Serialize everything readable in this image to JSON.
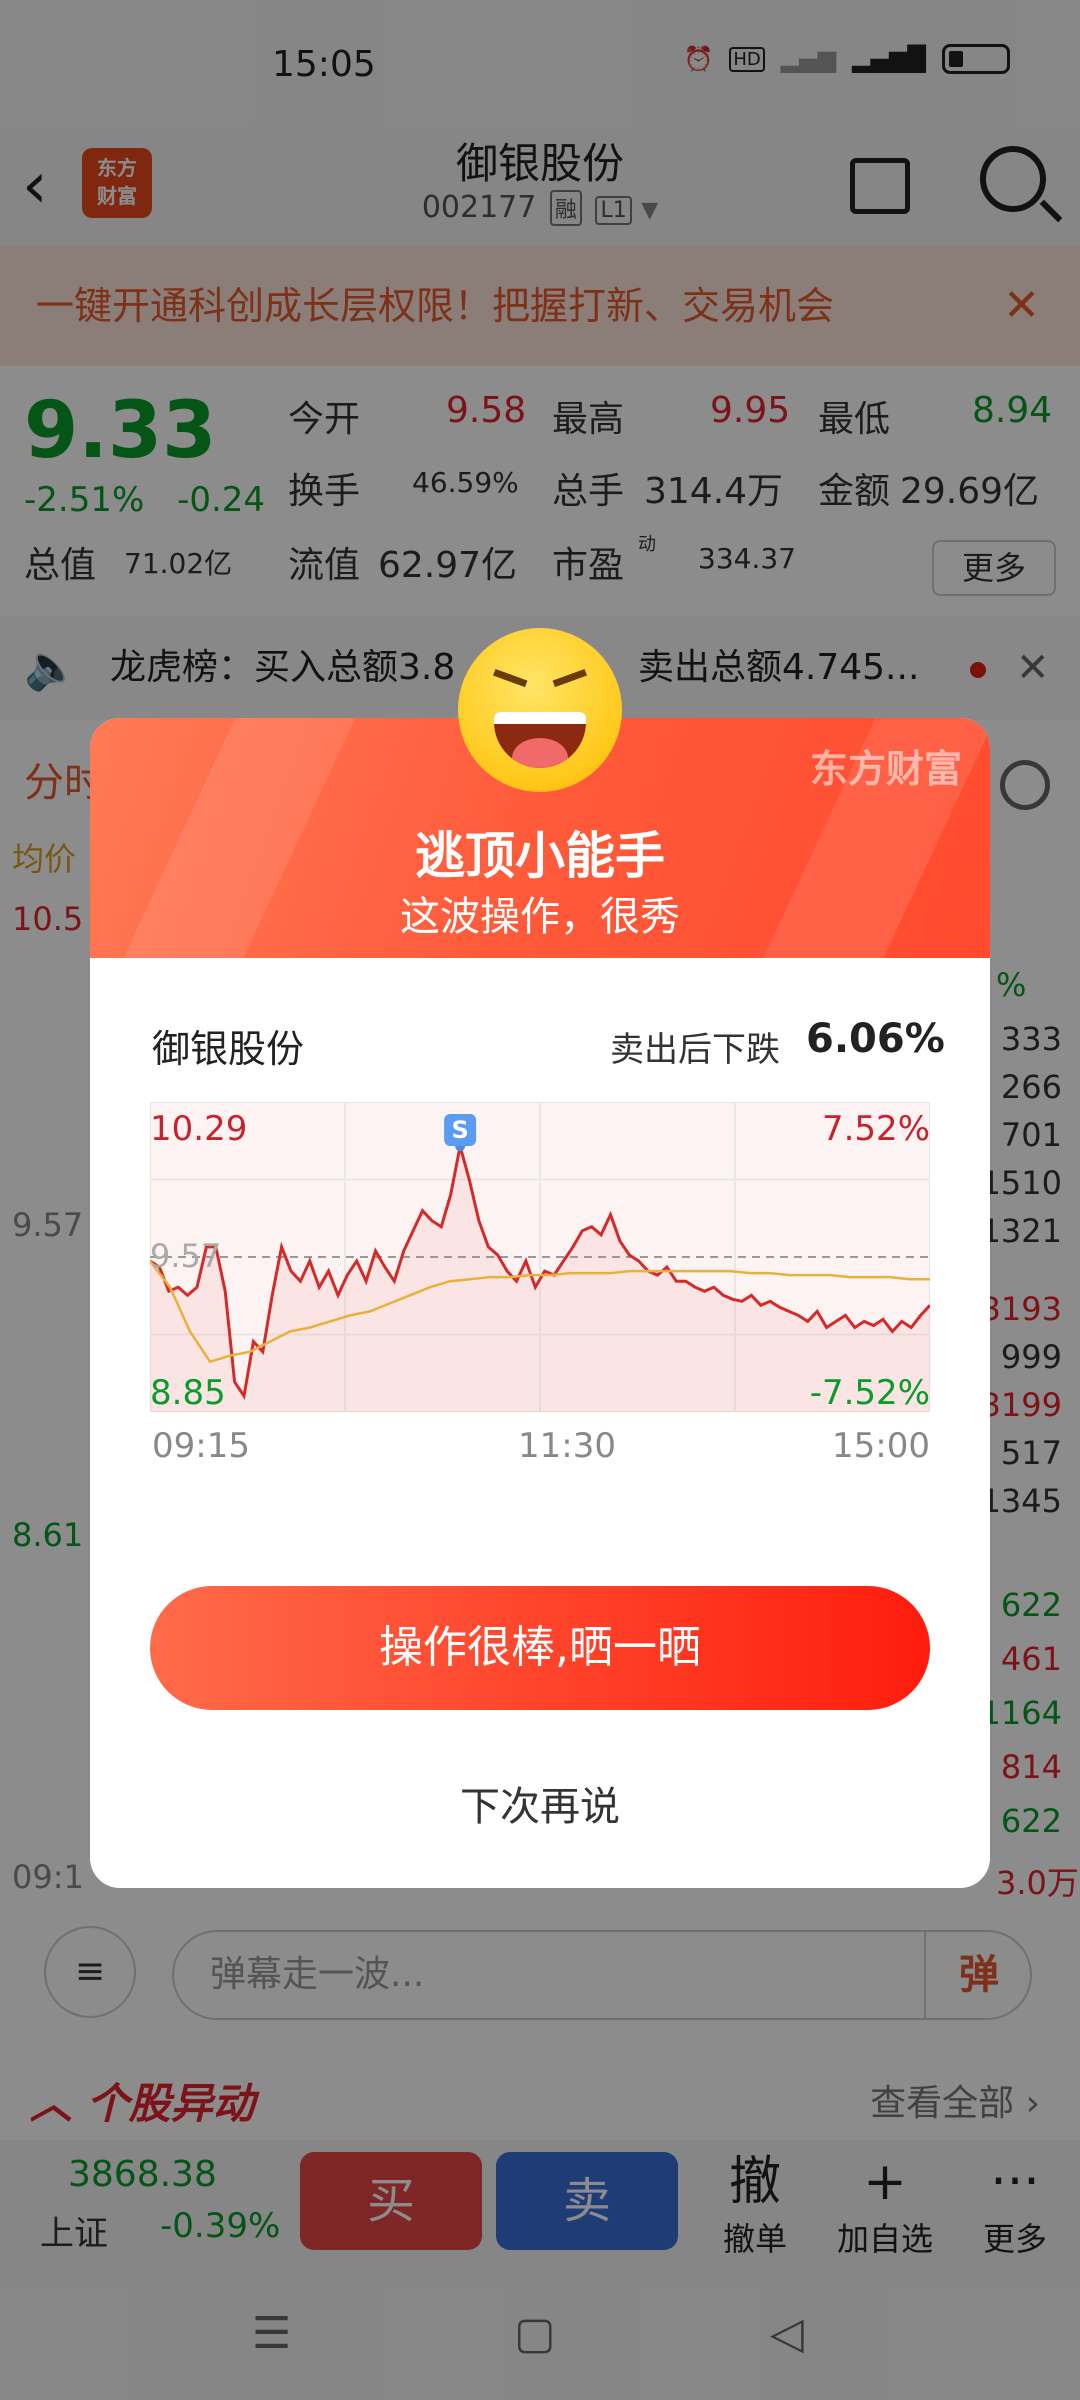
{
  "status": {
    "time": "15:05",
    "icons": [
      "alarm-icon",
      "hd-icon",
      "signal-icon",
      "4g-signal-icon",
      "battery-icon"
    ]
  },
  "header": {
    "title": "御银股份",
    "code": "002177",
    "tag_rong": "融",
    "tag_l1": "L1",
    "logo_line1": "东方",
    "logo_line2": "财富"
  },
  "promo": {
    "text": "一键开通科创成长层权限！把握打新、交易机会"
  },
  "quote": {
    "price": "9.33",
    "change_pct": "-2.51%",
    "change_abs": "-0.24",
    "fields": [
      {
        "label": "今开",
        "value": "9.58",
        "color": "#e3232c"
      },
      {
        "label": "最高",
        "value": "9.95",
        "color": "#e3232c"
      },
      {
        "label": "最低",
        "value": "8.94",
        "color": "#0a9b2a"
      },
      {
        "label": "换手",
        "value": "46.59%",
        "color": "#333333"
      },
      {
        "label": "总手",
        "value": "314.4万",
        "color": "#333333"
      },
      {
        "label": "金额",
        "value": "29.69亿",
        "color": "#333333"
      },
      {
        "label": "总值",
        "value": "71.02亿",
        "color": "#333333"
      },
      {
        "label": "流值",
        "value": "62.97亿",
        "color": "#333333"
      },
      {
        "label": "市盈",
        "value": "334.37",
        "color": "#333333"
      }
    ],
    "pe_sup": "动",
    "more": "更多"
  },
  "dragon": {
    "text": "龙虎榜：买入总额3.8",
    "text2": "卖出总额4.745..."
  },
  "background": {
    "tab_partial": "分时",
    "avg_label": "均价",
    "price_hi": "10.5",
    "price_mid": "9.57",
    "price_lo": "8.61",
    "time_label": "09:1",
    "right_pct": "%",
    "right_vals": [
      "333",
      "266",
      "701",
      "1510",
      "1321",
      "3193",
      "999",
      "3199",
      "517",
      "1345",
      "622",
      "461",
      "1164",
      "814",
      "622"
    ],
    "bottom_amount": "3.0万"
  },
  "danmu": {
    "placeholder": "弹幕走一波...",
    "send": "弹"
  },
  "abnormal": {
    "title": "个股异动",
    "all": "查看全部"
  },
  "bottom": {
    "index_value": "3868.38",
    "index_name": "上证",
    "index_change": "-0.39%",
    "buy": "买",
    "sell": "卖",
    "tools": [
      {
        "icon": "撤",
        "label": "撤单"
      },
      {
        "icon": "+",
        "label": "加自选"
      },
      {
        "icon": "···",
        "label": "更多"
      }
    ]
  },
  "modal": {
    "brand": "东方财富",
    "title": "逃顶小能手",
    "subtitle": "这波操作，很秀",
    "stock_name": "御银股份",
    "fall_label": "卖出后下跌",
    "fall_value": "6.06%",
    "share_button": "操作很棒,晒一晒",
    "later_button": "下次再说",
    "sell_marker": "S"
  },
  "chart_data": {
    "type": "line",
    "title": "",
    "x_ticks": [
      "09:15",
      "11:30",
      "15:00"
    ],
    "y_left_max": "10.29",
    "y_left_min": "8.85",
    "y_right_max": "7.52%",
    "y_right_min": "-7.52%",
    "prev_close_label": "9.57",
    "ylim": [
      8.85,
      10.29
    ],
    "prev_close": 9.57,
    "series": [
      {
        "values": [
          9.55,
          9.52,
          9.4,
          9.42,
          9.38,
          9.42,
          9.62,
          9.62,
          9.4,
          8.95,
          8.88,
          9.15,
          9.1,
          9.38,
          9.62,
          9.5,
          9.45,
          9.55,
          9.42,
          9.5,
          9.38,
          9.48,
          9.55,
          9.45,
          9.6,
          9.52,
          9.45,
          9.6,
          9.7,
          9.8,
          9.75,
          9.72,
          9.88,
          10.12,
          9.95,
          9.75,
          9.62,
          9.58,
          9.5,
          9.45,
          9.55,
          9.42,
          9.5,
          9.48,
          9.55,
          9.62,
          9.7,
          9.72,
          9.68,
          9.78,
          9.65,
          9.58,
          9.55,
          9.5,
          9.48,
          9.52,
          9.45,
          9.45,
          9.42,
          9.4,
          9.42,
          9.38,
          9.36,
          9.35,
          9.38,
          9.33,
          9.35,
          9.32,
          9.3,
          9.28,
          9.25,
          9.3,
          9.22,
          9.25,
          9.28,
          9.22,
          9.25,
          9.23,
          9.26,
          9.2,
          9.25,
          9.22,
          9.28,
          9.33
        ]
      },
      {
        "values": [
          9.55,
          9.42,
          9.2,
          9.05,
          9.08,
          9.1,
          9.15,
          9.2,
          9.22,
          9.25,
          9.28,
          9.3,
          9.34,
          9.38,
          9.42,
          9.45,
          9.46,
          9.47,
          9.47,
          9.48,
          9.48,
          9.49,
          9.49,
          9.49,
          9.5,
          9.5,
          9.5,
          9.5,
          9.5,
          9.5,
          9.49,
          9.49,
          9.48,
          9.48,
          9.48,
          9.47,
          9.47,
          9.47,
          9.46,
          9.46
        ]
      }
    ]
  }
}
